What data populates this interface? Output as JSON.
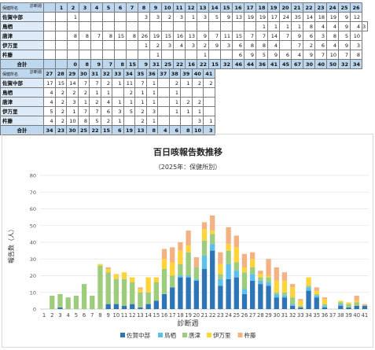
{
  "table1": {
    "corner_top": "診断週",
    "corner_bottom": "保健所名",
    "weeks": [
      "1",
      "2",
      "3",
      "4",
      "5",
      "6",
      "7",
      "8",
      "9",
      "10",
      "11",
      "12",
      "13",
      "14",
      "15",
      "16",
      "17",
      "18",
      "19",
      "20",
      "21",
      "22",
      "23",
      "24",
      "25",
      "26"
    ],
    "rows": [
      {
        "label": "佐賀中部",
        "cells": [
          "",
          "",
          "1",
          "",
          "",
          "",
          "",
          "",
          "3",
          "3",
          "2",
          "3",
          "1",
          "3",
          "5",
          "9",
          "13",
          "19",
          "19",
          "17",
          "24",
          "35",
          "14",
          "18",
          "19",
          "9",
          "12"
        ]
      },
      {
        "label": "鳥栖",
        "cells": [
          "",
          "",
          "",
          "",
          "",
          "",
          "",
          "",
          "",
          "",
          "",
          "",
          "",
          "",
          "",
          "",
          "",
          "",
          "1",
          "1",
          "1",
          "1",
          "8",
          "4",
          "4",
          "9",
          "4",
          "3"
        ]
      },
      {
        "label": "唐津",
        "cells": [
          "",
          "",
          "8",
          "8",
          "7",
          "8",
          "15",
          "8",
          "26",
          "19",
          "15",
          "16",
          "13",
          "9",
          "7",
          "11",
          "15",
          "7",
          "7",
          "14",
          "7",
          "9",
          "6",
          "3",
          "8",
          "5",
          "10"
        ]
      },
      {
        "label": "伊万里",
        "cells": [
          "",
          "",
          "",
          "",
          "",
          "",
          "",
          "",
          "1",
          "2",
          "3",
          "4",
          "3",
          "2",
          "9",
          "3",
          "6",
          "8",
          "8",
          "4",
          "",
          "7",
          "2",
          "6",
          "4",
          "9",
          "3"
        ]
      },
      {
        "label": "杵藤",
        "cells": [
          "",
          "",
          "",
          "",
          "",
          "",
          "",
          "",
          "",
          "1",
          "",
          "",
          "",
          "1",
          "",
          "",
          "6",
          "9",
          "5",
          "9",
          "6",
          "4",
          "9",
          "7",
          "10",
          "7",
          "8"
        ]
      }
    ],
    "total_label": "合計",
    "totals": [
      "0",
      "8",
      "9",
      "7",
      "8",
      "15",
      "9",
      "31",
      "25",
      "22",
      "16",
      "22",
      "15",
      "32",
      "46",
      "44",
      "36",
      "41",
      "45",
      "67",
      "30",
      "40",
      "50",
      "32",
      "34"
    ]
  },
  "table2": {
    "weeks": [
      "27",
      "28",
      "29",
      "30",
      "31",
      "32",
      "33",
      "34",
      "35",
      "36",
      "37",
      "38",
      "39",
      "40",
      "41"
    ],
    "rows": [
      {
        "label": "佐賀中部",
        "cells": [
          "17",
          "15",
          "14",
          "7",
          "7",
          "2",
          "1",
          "11",
          "7",
          "1",
          "",
          "2",
          "1",
          "2",
          "2"
        ]
      },
      {
        "label": "鳥栖",
        "cells": [
          "4",
          "2",
          "2",
          "2",
          "1",
          "1",
          "",
          "2",
          "1",
          "1",
          "",
          "1",
          "",
          "",
          ""
        ]
      },
      {
        "label": "唐津",
        "cells": [
          "4",
          "2",
          "3",
          "1",
          "2",
          "4",
          "1",
          "1",
          "1",
          "1",
          "",
          "1",
          "2",
          "2",
          ""
        ]
      },
      {
        "label": "伊万里",
        "cells": [
          "5",
          "2",
          "1",
          "7",
          "7",
          "6",
          "3",
          "5",
          "2",
          "3",
          "",
          "1",
          "1",
          "1",
          ""
        ]
      },
      {
        "label": "杵藤",
        "cells": [
          "4",
          "2",
          "10",
          "8",
          "5",
          "2",
          "1",
          "",
          "2",
          "1",
          "",
          "",
          "",
          "3",
          "1"
        ]
      }
    ],
    "total_label": "合計",
    "totals": [
      "34",
      "23",
      "30",
      "25",
      "22",
      "15",
      "6",
      "19",
      "13",
      "8",
      "4",
      "6",
      "8",
      "10",
      "3"
    ]
  },
  "chart_data": {
    "type": "bar",
    "stacked": true,
    "title": "百日咳報告数推移",
    "subtitle": "（2025年：保健所別）",
    "xlabel": "診断週",
    "ylabel": "報告数（人）",
    "ylim": [
      0,
      80
    ],
    "yticks": [
      0,
      10,
      20,
      30,
      40,
      50,
      60,
      70,
      80
    ],
    "grid": true,
    "legend_position": "bottom",
    "categories": [
      "1",
      "2",
      "3",
      "4",
      "5",
      "6",
      "7",
      "8",
      "9",
      "10",
      "11",
      "12",
      "13",
      "14",
      "15",
      "16",
      "17",
      "18",
      "19",
      "20",
      "21",
      "22",
      "23",
      "24",
      "25",
      "26",
      "27",
      "28",
      "29",
      "30",
      "31",
      "32",
      "33",
      "34",
      "35",
      "36",
      "37",
      "38",
      "39",
      "40",
      "41"
    ],
    "series": [
      {
        "name": "佐賀中部",
        "color": "#2e75b6",
        "values": [
          0,
          0,
          1,
          0,
          0,
          0,
          0,
          0,
          3,
          3,
          2,
          3,
          1,
          3,
          5,
          9,
          13,
          19,
          19,
          17,
          24,
          35,
          14,
          18,
          19,
          9,
          17,
          15,
          14,
          7,
          7,
          2,
          1,
          11,
          7,
          1,
          0,
          2,
          1,
          2,
          2
        ]
      },
      {
        "name": "鳥栖",
        "color": "#5bc0eb",
        "values": [
          0,
          0,
          0,
          0,
          0,
          0,
          0,
          0,
          0,
          0,
          0,
          0,
          0,
          0,
          0,
          0,
          0,
          1,
          1,
          1,
          8,
          4,
          4,
          9,
          4,
          3,
          4,
          2,
          2,
          2,
          1,
          1,
          0,
          2,
          1,
          1,
          0,
          1,
          0,
          0,
          0
        ]
      },
      {
        "name": "唐津",
        "color": "#9ccc7c",
        "values": [
          0,
          8,
          8,
          7,
          8,
          15,
          8,
          26,
          19,
          15,
          16,
          13,
          9,
          7,
          11,
          15,
          7,
          7,
          14,
          7,
          9,
          6,
          3,
          8,
          5,
          10,
          4,
          2,
          3,
          1,
          2,
          4,
          1,
          1,
          1,
          1,
          0,
          1,
          2,
          2,
          0
        ]
      },
      {
        "name": "伊万里",
        "color": "#ffd43b",
        "values": [
          0,
          0,
          0,
          0,
          0,
          0,
          0,
          1,
          2,
          3,
          4,
          3,
          2,
          9,
          3,
          6,
          8,
          8,
          4,
          0,
          7,
          2,
          6,
          4,
          9,
          3,
          5,
          2,
          1,
          7,
          7,
          6,
          3,
          5,
          2,
          3,
          0,
          1,
          1,
          1,
          0
        ]
      },
      {
        "name": "杵藤",
        "color": "#f4b183",
        "values": [
          0,
          0,
          0,
          0,
          0,
          0,
          0,
          0,
          1,
          0,
          0,
          0,
          1,
          0,
          0,
          6,
          9,
          5,
          9,
          6,
          4,
          9,
          7,
          10,
          7,
          8,
          4,
          2,
          10,
          8,
          5,
          2,
          1,
          0,
          2,
          1,
          0,
          0,
          0,
          3,
          1
        ]
      }
    ]
  }
}
